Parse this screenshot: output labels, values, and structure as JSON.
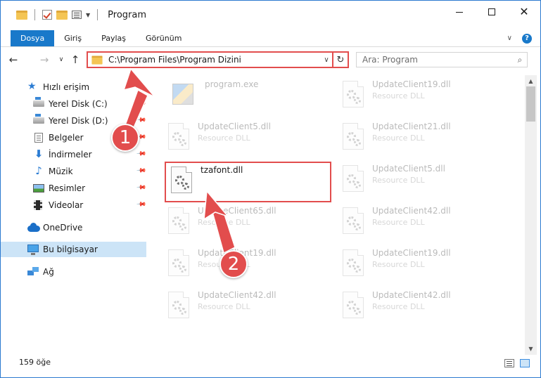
{
  "window": {
    "title": "Program",
    "controls": {
      "minimize": "—",
      "maximize": "☐",
      "close": "✕"
    }
  },
  "ribbon": {
    "tabs": [
      "Dosya",
      "Giriş",
      "Paylaş",
      "Görünüm"
    ],
    "help": "?"
  },
  "nav": {
    "back": "←",
    "forward": "→",
    "recent": "∨",
    "up": "↑",
    "address": "C:\\Program Files\\Program Dizini",
    "refresh": "↻",
    "search_placeholder": "Ara: Program"
  },
  "sidebar": {
    "quick_access": "Hızlı erişim",
    "items": [
      {
        "label": "Yerel Disk (C:)",
        "icon": "drive-icon",
        "pinned": true
      },
      {
        "label": "Yerel Disk (D:)",
        "icon": "drive-icon",
        "pinned": true
      },
      {
        "label": "Belgeler",
        "icon": "document-icon",
        "pinned": true
      },
      {
        "label": "İndirmeler",
        "icon": "download-icon",
        "pinned": true
      },
      {
        "label": "Müzik",
        "icon": "music-icon",
        "pinned": true
      },
      {
        "label": "Resimler",
        "icon": "pictures-icon",
        "pinned": true
      },
      {
        "label": "Videolar",
        "icon": "video-icon",
        "pinned": true
      }
    ],
    "onedrive": "OneDrive",
    "this_pc": "Bu bilgisayar",
    "network": "Ağ"
  },
  "files": {
    "left": [
      {
        "name": "program.exe",
        "type": "",
        "icon": "exe-icon",
        "ghost": true
      },
      {
        "name": "UpdateClient5.dll",
        "type": "Resource DLL",
        "icon": "dll-icon",
        "ghost": true
      },
      {
        "name": "tzafont.dll",
        "type": "",
        "icon": "dll-icon",
        "ghost": false
      },
      {
        "name": "UpdateClient65.dll",
        "type": "Resource DLL",
        "icon": "dll-icon",
        "ghost": true
      },
      {
        "name": "UpdateClient19.dll",
        "type": "Resource DLL",
        "icon": "dll-icon",
        "ghost": true
      },
      {
        "name": "UpdateClient42.dll",
        "type": "Resource DLL",
        "icon": "dll-icon",
        "ghost": true
      }
    ],
    "right": [
      {
        "name": "UpdateClient19.dll",
        "type": "Resource DLL",
        "icon": "dll-icon",
        "ghost": true
      },
      {
        "name": "UpdateClient21.dll",
        "type": "Resource DLL",
        "icon": "dll-icon",
        "ghost": true
      },
      {
        "name": "UpdateClient5.dll",
        "type": "Resource DLL",
        "icon": "dll-icon",
        "ghost": true
      },
      {
        "name": "UpdateClient42.dll",
        "type": "Resource DLL",
        "icon": "dll-icon",
        "ghost": true
      },
      {
        "name": "UpdateClient19.dll",
        "type": "Resource DLL",
        "icon": "dll-icon",
        "ghost": true
      },
      {
        "name": "UpdateClient42.dll",
        "type": "Resource DLL",
        "icon": "dll-icon",
        "ghost": true
      }
    ]
  },
  "status": {
    "item_count": "159 öğe"
  },
  "annotations": {
    "step1": "1",
    "step2": "2",
    "accent": "#e24d4d"
  }
}
